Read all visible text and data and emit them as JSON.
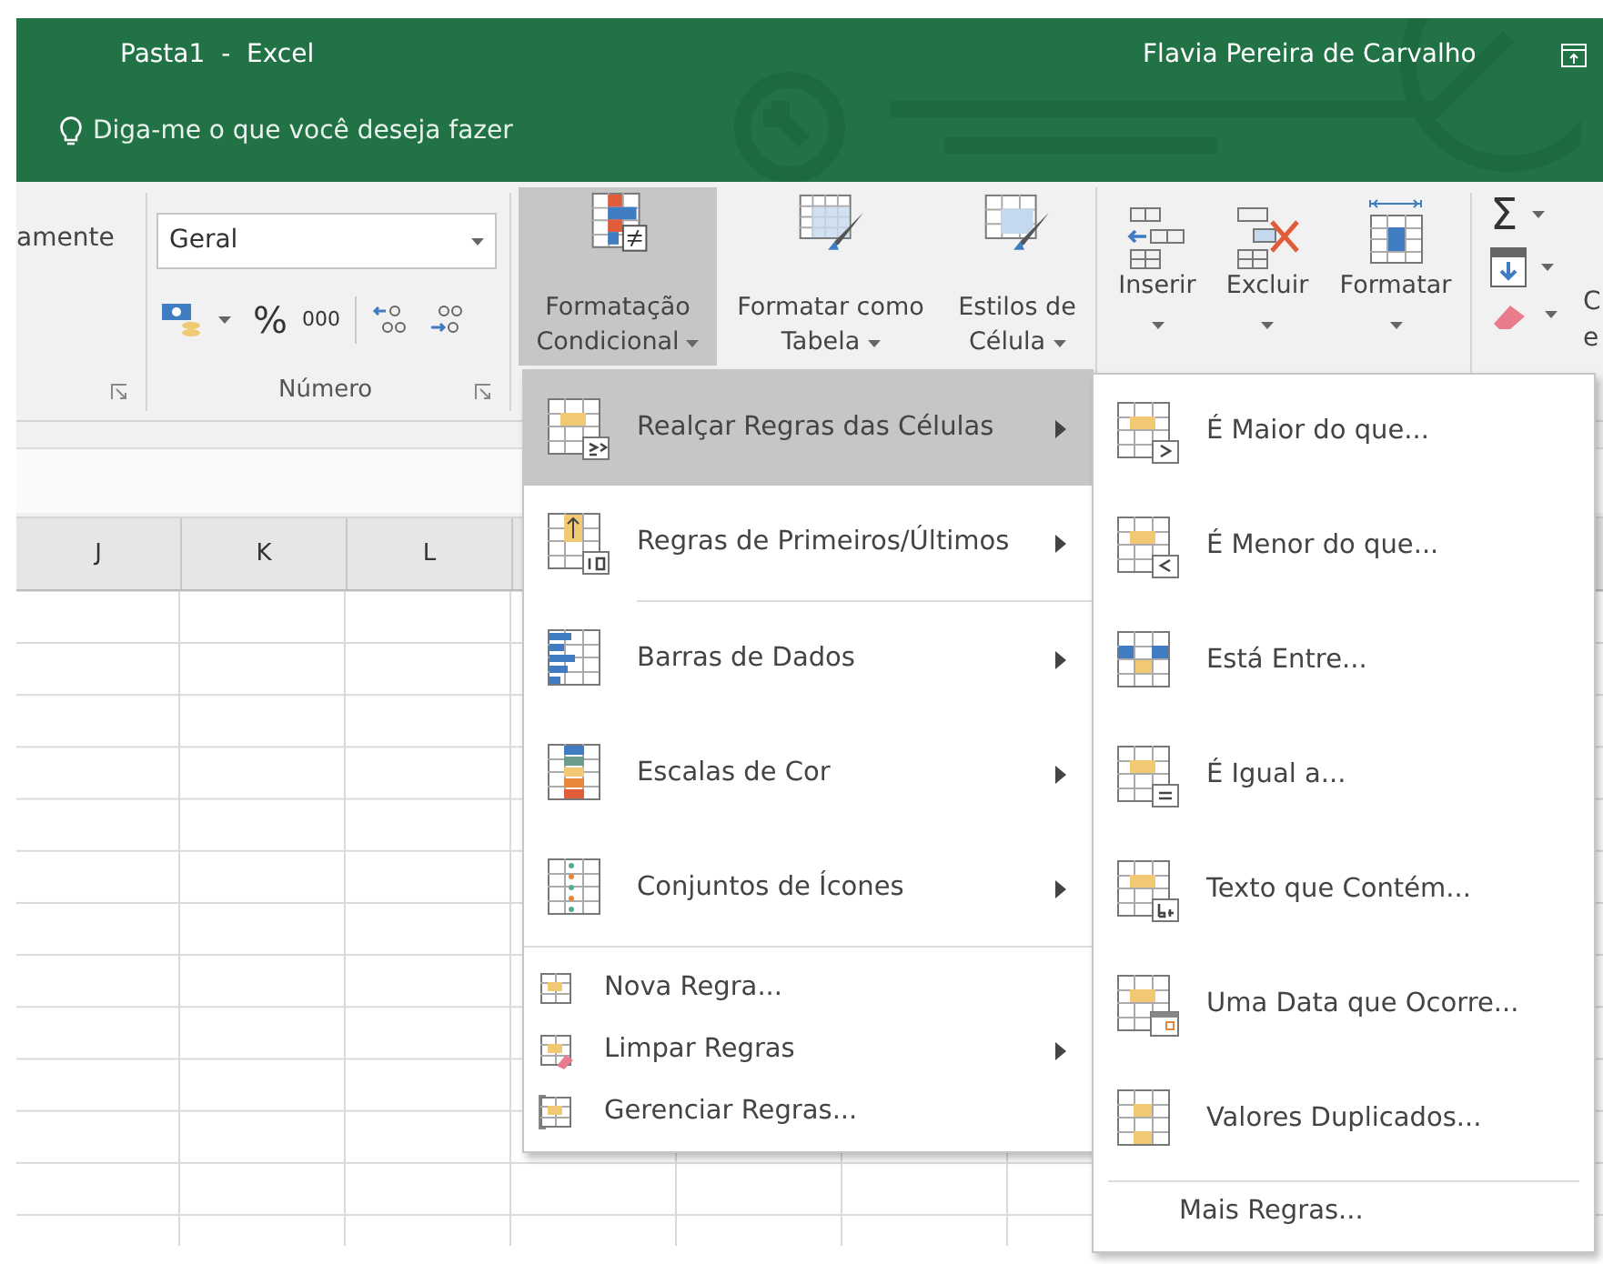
{
  "window": {
    "title": "Pasta1  -  Excel",
    "user": "Flavia Pereira de Carvalho"
  },
  "tell_me": {
    "placeholder": "Diga-me o que você deseja fazer"
  },
  "ribbon": {
    "alignment_group": {
      "label": "amente"
    },
    "number_group": {
      "format": "Geral",
      "label": "Número",
      "percent": "%",
      "thousands": "000"
    },
    "styles_group": [
      {
        "kind": "conditional",
        "lines": [
          "Formatação",
          "Condicional"
        ],
        "selected": true
      },
      {
        "kind": "table",
        "lines": [
          "Formatar como",
          "Tabela"
        ],
        "selected": false
      },
      {
        "kind": "cellstyle",
        "lines": [
          "Estilos de",
          "Célula"
        ],
        "selected": false
      }
    ],
    "cells_group": [
      {
        "kind": "insert",
        "label": "Inserir"
      },
      {
        "kind": "delete",
        "label": "Excluir"
      },
      {
        "kind": "format",
        "label": "Formatar"
      }
    ],
    "editing_group": {
      "sum": "Σ",
      "cut_texts": [
        "C",
        "e"
      ]
    }
  },
  "columns": [
    "J",
    "K",
    "L"
  ],
  "menu": {
    "items": [
      {
        "kind": "highlight",
        "label": "Realçar Regras das Células",
        "submenu": true,
        "selected": true
      },
      {
        "kind": "topbottom",
        "label": "Regras de Primeiros/Últimos",
        "submenu": true,
        "selected": false
      },
      {
        "kind": "databars",
        "label": "Barras de Dados",
        "submenu": true,
        "selected": false
      },
      {
        "kind": "colorscales",
        "label": "Escalas de Cor",
        "submenu": true,
        "selected": false
      },
      {
        "kind": "iconsets",
        "label": "Conjuntos de Ícones",
        "submenu": true,
        "selected": false
      }
    ],
    "small_items": [
      {
        "kind": "new",
        "label": "Nova Regra...",
        "submenu": false
      },
      {
        "kind": "clear",
        "label": "Limpar Regras",
        "submenu": true
      },
      {
        "kind": "manage",
        "label": "Gerenciar Regras...",
        "submenu": false
      }
    ]
  },
  "submenu": {
    "items": [
      {
        "kind": "greater",
        "label": "É Maior do que..."
      },
      {
        "kind": "less",
        "label": "É Menor do que..."
      },
      {
        "kind": "between",
        "label": "Está Entre..."
      },
      {
        "kind": "equal",
        "label": "É Igual a..."
      },
      {
        "kind": "text",
        "label": "Texto que Contém..."
      },
      {
        "kind": "date",
        "label": "Uma Data que Ocorre..."
      },
      {
        "kind": "duplicate",
        "label": "Valores Duplicados..."
      }
    ],
    "footer": "Mais Regras..."
  }
}
